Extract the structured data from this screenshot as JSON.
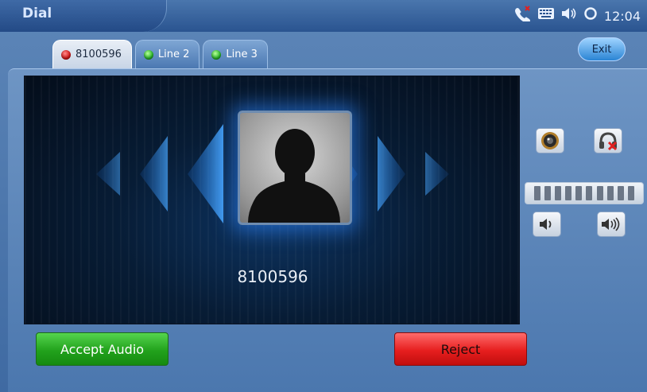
{
  "header": {
    "title": "Dial",
    "time": "12:04",
    "status_icons": [
      "missed-call-icon",
      "keyboard-icon",
      "speaker-icon",
      "sync-icon"
    ]
  },
  "tabs": [
    {
      "label": "8100596",
      "status": "red",
      "active": true
    },
    {
      "label": "Line 2",
      "status": "green",
      "active": false
    },
    {
      "label": "Line 3",
      "status": "green",
      "active": false
    }
  ],
  "exit_label": "Exit",
  "call": {
    "caller_number": "8100596"
  },
  "controls": {
    "camera_icon": "camera-icon",
    "headset_icon": "headset-muted-icon",
    "volume_down_icon": "volume-down-icon",
    "volume_up_icon": "volume-up-icon",
    "volume_level": 1.0
  },
  "actions": {
    "accept_label": "Accept Audio",
    "reject_label": "Reject"
  },
  "colors": {
    "accept": "#22a21c",
    "reject": "#e61e1e",
    "tab_status_red": "#d51818",
    "tab_status_green": "#29b82a"
  }
}
